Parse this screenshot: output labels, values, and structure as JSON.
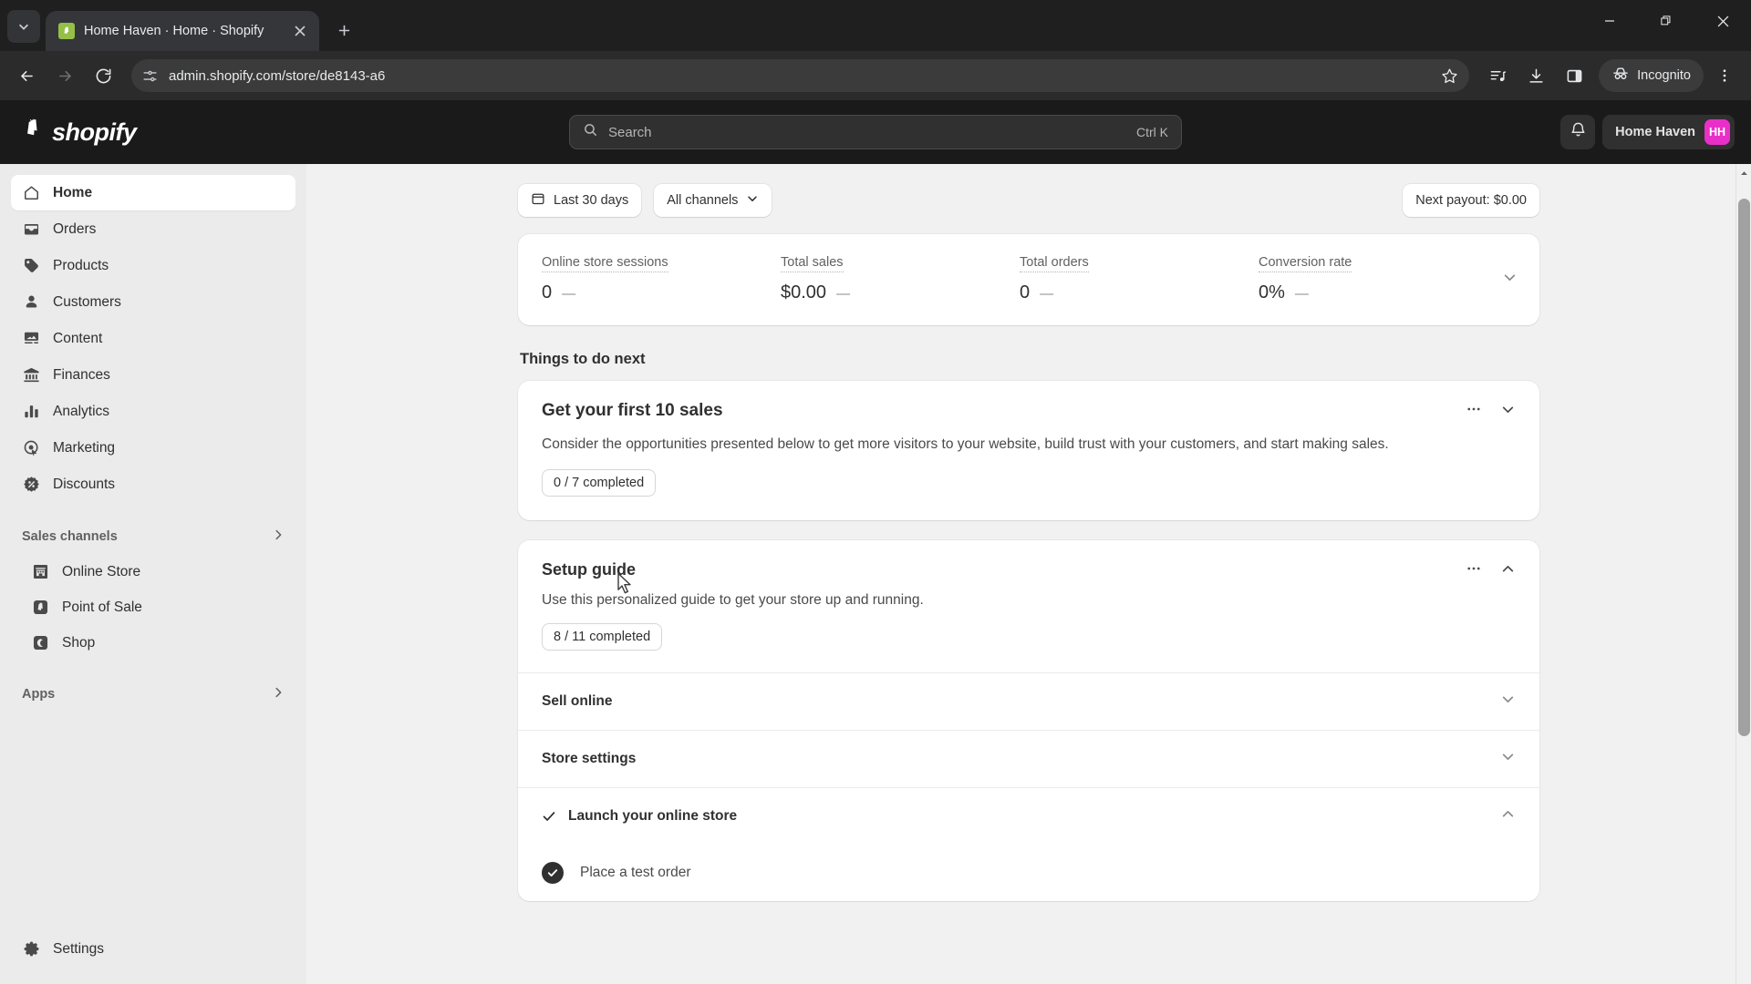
{
  "browser": {
    "tab": {
      "title": "Home Haven · Home · Shopify",
      "favicon_name": "shopify-favicon",
      "close_label": "×"
    },
    "new_tab_label": "+",
    "window_controls": {
      "minimize": "−",
      "restore": "❐",
      "close": "✕"
    },
    "nav": {
      "back": "←",
      "forward": "→",
      "reload": "⟳"
    },
    "url": "admin.shopify.com/store/de8143-a6",
    "toolbar_icons": [
      "site-info-icon",
      "bookmark-star-icon",
      "media-playlist-icon",
      "downloads-icon",
      "side-panel-icon",
      "browser-menu-icon"
    ],
    "incognito_label": "Incognito"
  },
  "topbar": {
    "logo_text": "shopify",
    "search": {
      "placeholder": "Search",
      "shortcut": "Ctrl K",
      "value": ""
    },
    "notifications_icon": "bell-icon",
    "store_name": "Home Haven",
    "store_initials": "HH",
    "avatar_color": "#e830c8"
  },
  "sidebar": {
    "items": [
      {
        "label": "Home",
        "icon": "home-icon",
        "active": true
      },
      {
        "label": "Orders",
        "icon": "orders-inbox-icon",
        "active": false
      },
      {
        "label": "Products",
        "icon": "products-tag-icon",
        "active": false
      },
      {
        "label": "Customers",
        "icon": "customers-person-icon",
        "active": false
      },
      {
        "label": "Content",
        "icon": "content-image-icon",
        "active": false
      },
      {
        "label": "Finances",
        "icon": "finances-bank-icon",
        "active": false
      },
      {
        "label": "Analytics",
        "icon": "analytics-bars-icon",
        "active": false
      },
      {
        "label": "Marketing",
        "icon": "marketing-target-icon",
        "active": false
      },
      {
        "label": "Discounts",
        "icon": "discounts-percent-icon",
        "active": false
      }
    ],
    "sales_channels": {
      "title": "Sales channels",
      "chevron": "chevron-right-icon",
      "items": [
        {
          "label": "Online Store",
          "icon": "online-store-icon"
        },
        {
          "label": "Point of Sale",
          "icon": "point-of-sale-icon"
        },
        {
          "label": "Shop",
          "icon": "shop-icon"
        }
      ]
    },
    "apps": {
      "title": "Apps",
      "chevron": "chevron-right-icon"
    },
    "settings": {
      "label": "Settings",
      "icon": "gear-icon"
    }
  },
  "main": {
    "filters": {
      "date_range": {
        "label": "Last 30 days",
        "icon": "calendar-icon"
      },
      "channels": {
        "label": "All channels",
        "icon": "chevron-down-icon"
      },
      "next_payout": {
        "label": "Next payout: $0.00"
      }
    },
    "metrics": {
      "expand_icon": "chevron-down-icon",
      "items": [
        {
          "label": "Online store sessions",
          "value": "0",
          "delta": "—"
        },
        {
          "label": "Total sales",
          "value": "$0.00",
          "delta": "—"
        },
        {
          "label": "Total orders",
          "value": "0",
          "delta": "—"
        },
        {
          "label": "Conversion rate",
          "value": "0%",
          "delta": "—"
        }
      ]
    },
    "things_to_do": {
      "section_title": "Things to do next",
      "card": {
        "title": "Get your first 10 sales",
        "description": "Consider the opportunities presented below to get more visitors to your website, build trust with your customers, and start making sales.",
        "progress": "0 / 7 completed",
        "more_icon": "ellipsis-icon",
        "collapse_icon": "chevron-down-icon"
      }
    },
    "setup_guide": {
      "title": "Setup guide",
      "description": "Use this personalized guide to get your store up and running.",
      "progress": "8 / 11 completed",
      "more_icon": "ellipsis-icon",
      "collapse_icon": "chevron-up-icon",
      "sections": [
        {
          "label": "Sell online",
          "expanded": false,
          "chevron": "chevron-down-icon",
          "completed": false
        },
        {
          "label": "Store settings",
          "expanded": false,
          "chevron": "chevron-down-icon",
          "completed": false
        },
        {
          "label": "Launch your online store",
          "expanded": true,
          "chevron": "chevron-up-icon",
          "completed": true
        }
      ],
      "subtasks": [
        {
          "label": "Place a test order",
          "done": true
        }
      ]
    }
  }
}
